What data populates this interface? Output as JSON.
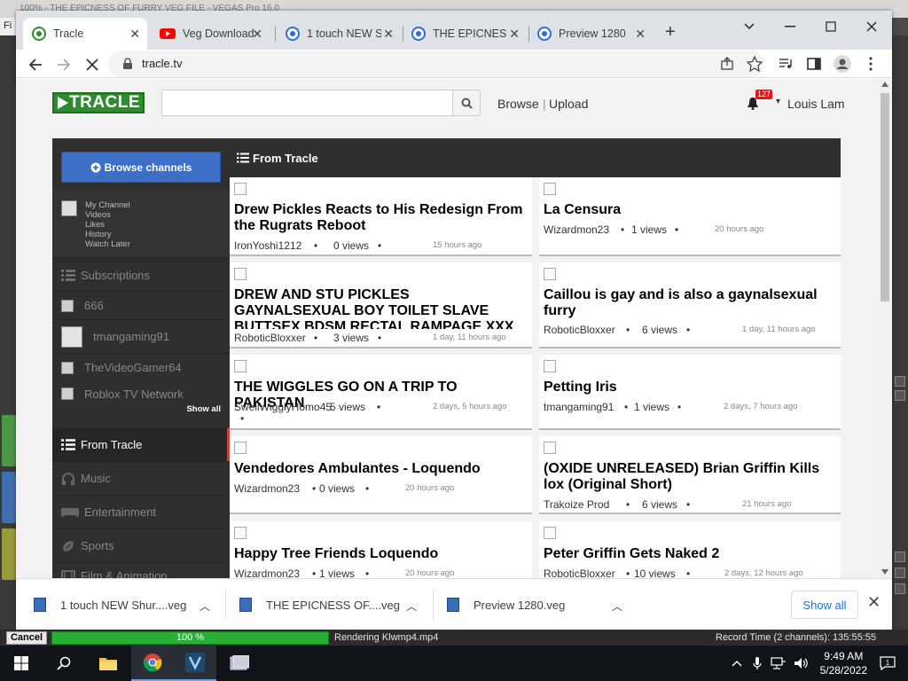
{
  "background_app": {
    "title": "100% - THE EPICNESS OF FURRY VEG FILE - VEGAS Pro 16.0",
    "menu_first": "Fi"
  },
  "browser": {
    "tabs": [
      {
        "title": "Tracle",
        "icon": "tracle-favicon",
        "active": true
      },
      {
        "title": "Veg Download",
        "icon": "youtube-favicon"
      },
      {
        "title": "1 touch NEW S",
        "icon": "tracle-favicon"
      },
      {
        "title": "THE EPICNESS",
        "icon": "tracle-favicon"
      },
      {
        "title": "Preview 1280",
        "icon": "tracle-favicon"
      }
    ],
    "url": "tracle.tv"
  },
  "site": {
    "logo": "TRACLE",
    "search_placeholder": "",
    "nav": {
      "browse": "Browse",
      "separator": "|",
      "upload": "Upload"
    },
    "notifications": "127",
    "user": "Louis Lam"
  },
  "sidebar": {
    "browse_channels": "Browse channels",
    "my_links": [
      "My Channel",
      "Videos",
      "Likes",
      "History",
      "Watch Later"
    ],
    "subscriptions": "Subscriptions",
    "channels": [
      "666",
      "tmangaming91",
      "TheVideoGamer64",
      "Roblox TV Network"
    ],
    "show_all": "Show all",
    "categories": [
      "From Tracle",
      "Music",
      "Entertainment",
      "Sports",
      "Film & Animation"
    ]
  },
  "content": {
    "header": "From Tracle",
    "videos": [
      {
        "title": "Drew Pickles Reacts to His Redesign From the Rugrats Reboot",
        "author": "IronYoshi1212",
        "views": "0 views",
        "age": "15 hours ago"
      },
      {
        "title": "La Censura",
        "author": "Wizardmon23",
        "views": "1 views",
        "age": "20 hours ago"
      },
      {
        "title": "DREW AND STU PICKLES GAYNALSEXUAL BOY TOILET SLAVE BUTTSEX BDSM RECTAL RAMPAGE XXX",
        "author": "RoboticBloxxer",
        "views": "3 views",
        "age": "1 day, 11 hours ago"
      },
      {
        "title": "Caillou is gay and is also a gaynalsexual furry",
        "author": "RoboticBloxxer",
        "views": "6 views",
        "age": "1 day, 11 hours ago"
      },
      {
        "title": "THE WIGGLES GO ON A TRIP TO PAKISTAN",
        "author": "SwellWigglyHomo45",
        "views": "5 views",
        "age": "2 days, 5 hours ago"
      },
      {
        "title": "Petting Iris",
        "author": "tmangaming91",
        "views": "1 views",
        "age": "2 days, 7 hours ago"
      },
      {
        "title": "Vendedores Ambulantes - Loquendo",
        "author": "Wizardmon23",
        "views": "0 views",
        "age": "20 hours ago"
      },
      {
        "title": "(OXIDE UNRELEASED) Brian Griffin Kills lox (Original Short)",
        "author": "Trakoize Prod",
        "views": "6 views",
        "age": "21 hours ago"
      },
      {
        "title": "Happy Tree Friends Loquendo",
        "author": "Wizardmon23",
        "views": "1 views",
        "age": "20 hours ago"
      },
      {
        "title": "Peter Griffin Gets Naked 2",
        "author": "RoboticBloxxer",
        "views": "10 views",
        "age": "2 days, 12 hours ago"
      }
    ]
  },
  "downloads": {
    "items": [
      "1 touch NEW Shur....veg",
      "THE EPICNESS OF....veg",
      "Preview 1280.veg"
    ],
    "show_all": "Show all"
  },
  "statusbar": {
    "cancel": "Cancel",
    "progress": "100 %",
    "progress_fraction": 1.0,
    "rendering": "Rendering Klwmp4.mp4",
    "record_time": "Record Time (2 channels): 135:55:55"
  },
  "taskbar": {
    "time": "9:49 AM",
    "date": "5/28/2022"
  },
  "colors": {
    "logo_green": "#2d8c2d",
    "browse_button_blue": "#3e6fc7",
    "progress_green": "#27b037",
    "notification_red": "#e11111"
  }
}
